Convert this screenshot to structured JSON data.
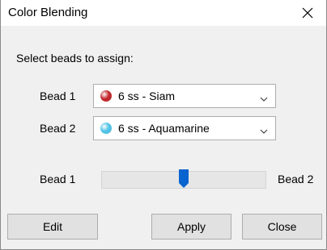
{
  "window": {
    "title": "Color Blending",
    "close_icon": "close-icon"
  },
  "prompt": "Select beads to assign:",
  "bead1": {
    "label": "Bead 1",
    "selected": "6 ss - Siam",
    "swatch_color": "#c1272d",
    "icon": "bead-swatch-icon"
  },
  "bead2": {
    "label": "Bead 2",
    "selected": "6 ss - Aquamarine",
    "swatch_color": "#4fc3e6",
    "icon": "bead-swatch-icon"
  },
  "slider": {
    "left_label": "Bead 1",
    "right_label": "Bead 2",
    "value_fraction": 0.5,
    "thumb_color": "#0a64d0"
  },
  "buttons": {
    "edit": "Edit",
    "apply": "Apply",
    "close": "Close"
  }
}
